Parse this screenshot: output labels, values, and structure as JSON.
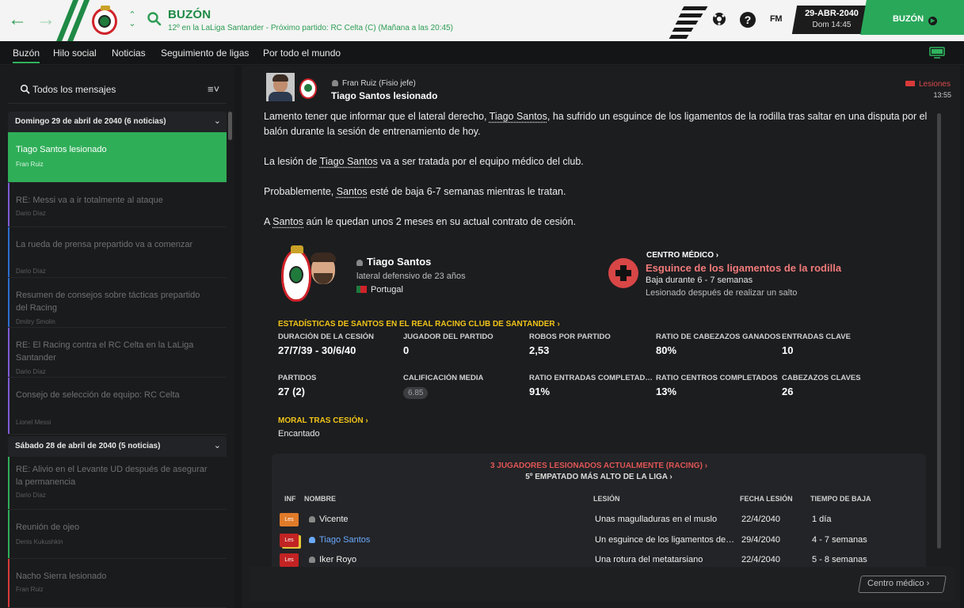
{
  "header": {
    "title": "BUZÓN",
    "subtitle": "12º en la LaLiga Santander - Próximo partido: RC Celta (C)  (Mañana a las 20:45)",
    "fm_label": "FM",
    "help_label": "?",
    "date_main": "29-ABR-2040",
    "date_sub": "Dom 14:45",
    "continue_label": "BUZÓN",
    "accent_color": "#29a85a"
  },
  "tabs": [
    "Buzón",
    "Hilo social",
    "Noticias",
    "Seguimiento de ligas",
    "Por todo el mundo"
  ],
  "inbox": {
    "filter_label": "Todos los mensajes",
    "groups": [
      {
        "title": "Domingo 29 de abril de 2040 (6 noticias)"
      },
      {
        "title": "Sábado 28 de abril de 2040 (5 noticias)"
      }
    ],
    "messages": [
      {
        "title": "Tiago Santos lesionado",
        "from": "Fran Ruiz",
        "color": "#d93a3a"
      },
      {
        "title": "RE: Messi va a ir totalmente al ataque",
        "from": "Dario Díaz",
        "color": "#7e5bd6"
      },
      {
        "title": "La rueda de prensa prepartido va a comenzar",
        "from": "Dario Díaz",
        "color": "#2c6fd1"
      },
      {
        "title": "Resumen de consejos sobre tácticas prepartido del Racing",
        "from": "Dmitry Smolin",
        "color": "#2c6fd1"
      },
      {
        "title": "RE: El Racing contra el RC Celta en la LaLiga Santander",
        "from": "Dario Díaz",
        "color": "#7e5bd6"
      },
      {
        "title": "Consejo de selección de equipo: RC Celta",
        "from": "Lionel Messi",
        "color": "#7e5bd6"
      },
      {
        "title": "RE: Alivio en el Levante UD después de asegurar la permanencia",
        "from": "Dario Díaz",
        "color": "#2fae58"
      },
      {
        "title": "Reunión de ojeo",
        "from": "Denis Kukushkin",
        "color": "#2fae58"
      },
      {
        "title": "Nacho Sierra lesionado",
        "from": "Fran Ruiz",
        "color": "#d93a3a"
      }
    ]
  },
  "message": {
    "sender": "Fran Ruiz  (Fisio jefe)",
    "subject": "Tiago Santos lesionado",
    "tag": "Lesiones",
    "time": "13:55",
    "body": {
      "p1a": "Lamento tener que informar que el lateral derecho, ",
      "p1b": "Tiago Santos",
      "p1c": ", ha sufrido un esguince de los ligamentos de la rodilla tras saltar en una disputa por el balón durante la sesión de entrenamiento de hoy.",
      "p2a": "La lesión de ",
      "p2b": "Tiago Santos",
      "p2c": " va a ser tratada por el equipo médico del club.",
      "p3a": "Probablemente, ",
      "p3b": "Santos",
      "p3c": " esté de baja 6-7 semanas mientras le tratan.",
      "p4a": "A ",
      "p4b": "Santos",
      "p4c": " aún le quedan unos 2 meses en su actual contrato de cesión."
    }
  },
  "player": {
    "name": "Tiago Santos",
    "description": "lateral defensivo de 23 años",
    "nationality": "Portugal"
  },
  "medical": {
    "link": "CENTRO MÉDICO",
    "injury": "Esguince de los ligamentos de la rodilla",
    "duration": "Baja durante 6 - 7 semanas",
    "cause": "Lesionado después de realizar un salto"
  },
  "stats": {
    "header": "ESTADÍSTICAS DE SANTOS EN EL REAL RACING CLUB DE SANTANDER",
    "items": [
      {
        "label": "DURACIÓN DE LA CESIÓN",
        "value": "27/7/39 - 30/6/40"
      },
      {
        "label": "JUGADOR DEL PARTIDO",
        "value": "0"
      },
      {
        "label": "ROBOS POR PARTIDO",
        "value": "2,53"
      },
      {
        "label": "RATIO DE CABEZAZOS GANADOS",
        "value": "80%"
      },
      {
        "label": "ENTRADAS CLAVE",
        "value": "10"
      },
      {
        "label": "PARTIDOS",
        "value": "27 (2)"
      },
      {
        "label": "CALIFICACIÓN MEDIA",
        "value": "6.85"
      },
      {
        "label": "RATIO ENTRADAS COMPLETADAS",
        "value": "91%"
      },
      {
        "label": "RATIO CENTROS COMPLETADOS",
        "value": "13%"
      },
      {
        "label": "CABEZAZOS CLAVES",
        "value": "26"
      }
    ]
  },
  "morale": {
    "label": "MORAL TRAS CESIÓN",
    "value": "Encantado"
  },
  "injuries": {
    "title": "3 JUGADORES LESIONADOS ACTUALMENTE (RACING)",
    "subtitle": "5º EMPATADO MÁS ALTO DE LA LIGA",
    "columns": [
      "INF",
      "NOMBRE",
      "LESIÓN",
      "FECHA LESIÓN",
      "TIEMPO DE BAJA"
    ],
    "rows": [
      {
        "badge": "Les",
        "name": "Vicente",
        "injury": "Unas magulladuras en el muslo",
        "date": "22/4/2040",
        "out": "1 día"
      },
      {
        "badge": "Les",
        "name": "Tiago Santos",
        "injury": "Un esguince de los ligamentos de la rodilla",
        "date": "29/4/2040",
        "out": "4 - 7 semanas"
      },
      {
        "badge": "Les",
        "name": "Iker Royo",
        "injury": "Una rotura del metatarsiano",
        "date": "22/4/2040",
        "out": "5 - 8 semanas"
      }
    ]
  },
  "footer": {
    "button_label": "Centro médico"
  }
}
